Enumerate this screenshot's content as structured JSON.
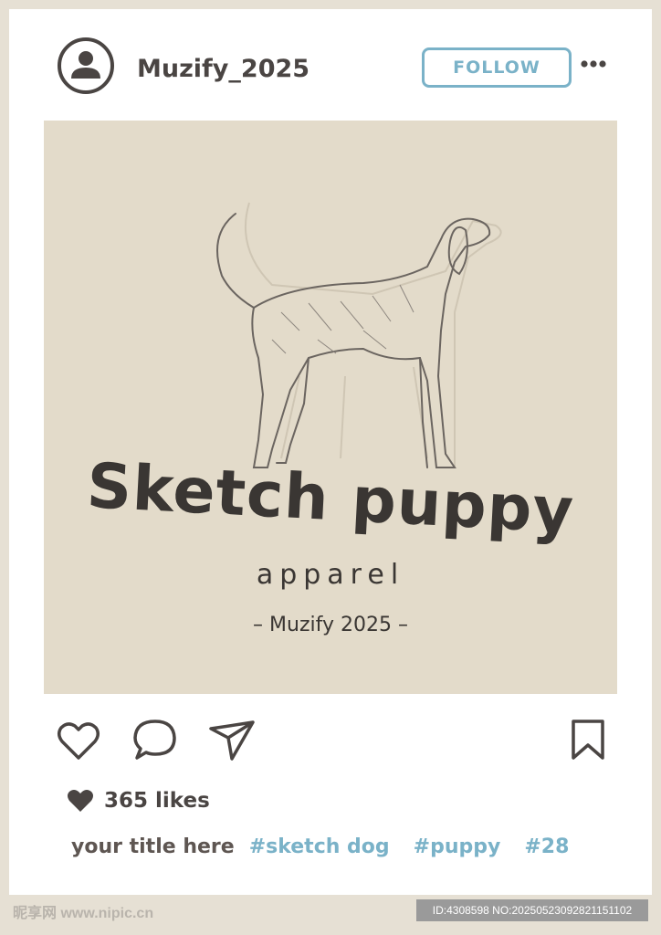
{
  "post": {
    "username": "Muzify_2025",
    "follow_label": "FOLLOW",
    "likes": "365 likes",
    "caption_title": "your title here",
    "hashtags": [
      "#sketch dog",
      "#puppy",
      "#28"
    ]
  },
  "artwork": {
    "title": "Sketch puppy",
    "subtitle": "apparel",
    "brand": "– Muzify 2025 –"
  },
  "icons": [
    "avatar-icon",
    "more-options-icon",
    "heart-icon",
    "comment-icon",
    "share-icon",
    "bookmark-icon"
  ],
  "colors": {
    "accent": "#7ab2c8",
    "text": "#4a4543",
    "post_background": "#e3dbca",
    "page_background": "#e6e0d4"
  },
  "footer": {
    "watermark": "昵享网 www.nipic.cn",
    "id_text": "ID:4308598 NO:20250523092821151102"
  }
}
